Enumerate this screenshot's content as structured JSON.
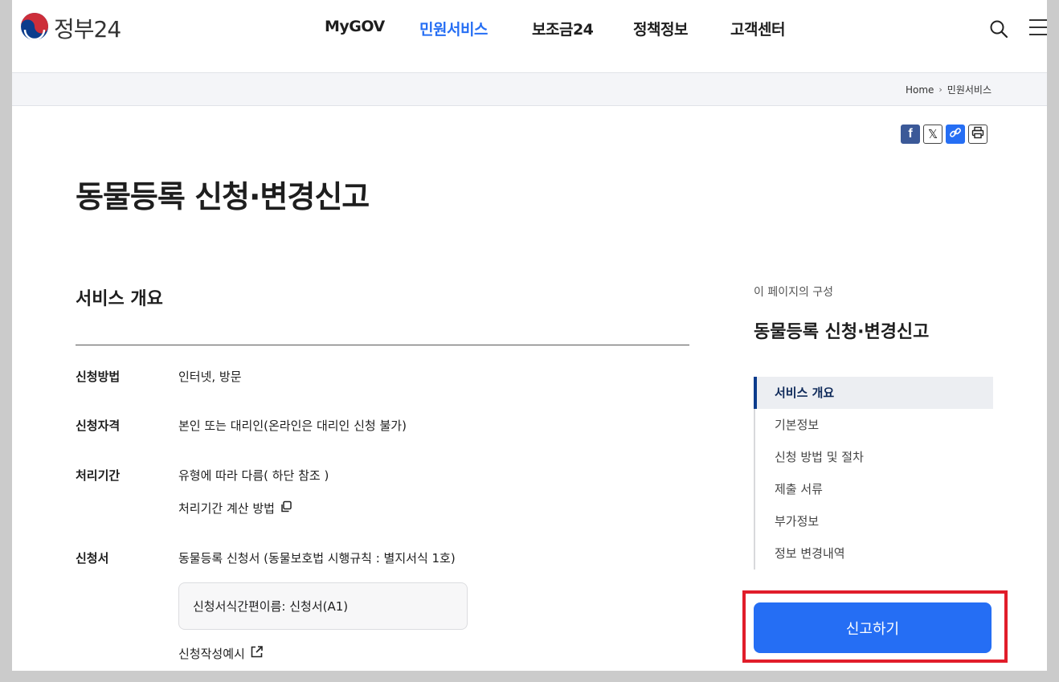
{
  "header": {
    "logo_text": "정부24",
    "nav": [
      "MyGOV",
      "민원서비스",
      "보조금24",
      "정책정보",
      "고객센터"
    ],
    "active_nav_index": 1
  },
  "breadcrumb": {
    "home": "Home",
    "current": "민원서비스"
  },
  "share": {
    "facebook": "f",
    "x": "𝕏"
  },
  "page_title": "동물등록 신청·변경신고",
  "overview": {
    "section_title": "서비스 개요",
    "rows": [
      {
        "label": "신청방법",
        "value": "인터넷, 방문"
      },
      {
        "label": "신청자격",
        "value": "본인 또는 대리인(온라인은 대리인 신청 불가)"
      },
      {
        "label": "처리기간",
        "value": "유형에 따라 다름( 하단 참조 )",
        "link": "처리기간 계산 방법"
      },
      {
        "label": "신청서",
        "value": "동물등록 신청서 (동물보호법 시행규칙 : 별지서식 1호)",
        "box": "신청서식간편이름: 신청서(A1)",
        "link": "신청작성예시"
      }
    ]
  },
  "toc": {
    "caption": "이 페이지의 구성",
    "title": "동물등록 신청·변경신고",
    "items": [
      "서비스 개요",
      "기본정보",
      "신청 방법 및 절차",
      "제출 서류",
      "부가정보",
      "정보 변경내역"
    ],
    "active_index": 0
  },
  "apply_button": "신고하기",
  "colors": {
    "primary": "#256ef4",
    "highlight": "#e11d2a",
    "toc_active_bar": "#0b3c8c"
  }
}
